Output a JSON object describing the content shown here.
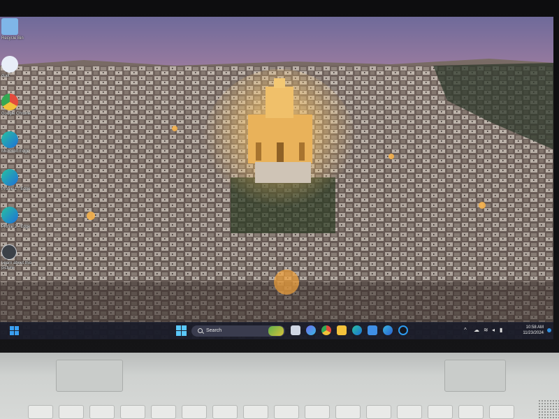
{
  "desktop": {
    "icons": [
      {
        "label": "Recycle Bin",
        "icon": "recycle-bin-icon",
        "color": "#7fb6e8"
      },
      {
        "label": "duet",
        "icon": "duet-icon",
        "color": "#e8eef8"
      },
      {
        "label": "Google Chrome",
        "icon": "chrome-icon",
        "color": "#e34b3c"
      },
      {
        "label": "Microsoft Edge",
        "icon": "edge-icon",
        "color": "#1fa0d8"
      },
      {
        "label": "Profile 1 - Edge",
        "icon": "edge-profile-1-icon",
        "color": "#1fa0d8"
      },
      {
        "label": "Profile 2 - Edge",
        "icon": "edge-profile-2-icon",
        "color": "#1fa0d8"
      },
      {
        "label": "Learn about this picture",
        "icon": "learn-picture-icon",
        "color": "#3c4148"
      }
    ]
  },
  "taskbar": {
    "search_label": "Search",
    "apps": [
      {
        "name": "task-view-icon",
        "color": "#cfd6e4"
      },
      {
        "name": "copilot-icon",
        "color": "#6f6cf0"
      },
      {
        "name": "chrome-icon",
        "color": "#e34b3c"
      },
      {
        "name": "file-explorer-icon",
        "color": "#f2c13b"
      },
      {
        "name": "edge-icon",
        "color": "#1fa0d8"
      },
      {
        "name": "store-icon",
        "color": "#3f8fe6"
      },
      {
        "name": "edge-dev-icon",
        "color": "#39b7e0"
      },
      {
        "name": "cortana-icon",
        "color": "#2d9bf0"
      }
    ],
    "clock_time": "10:58 AM",
    "clock_date": "11/23/2024"
  },
  "accent": "#3aa0f2"
}
